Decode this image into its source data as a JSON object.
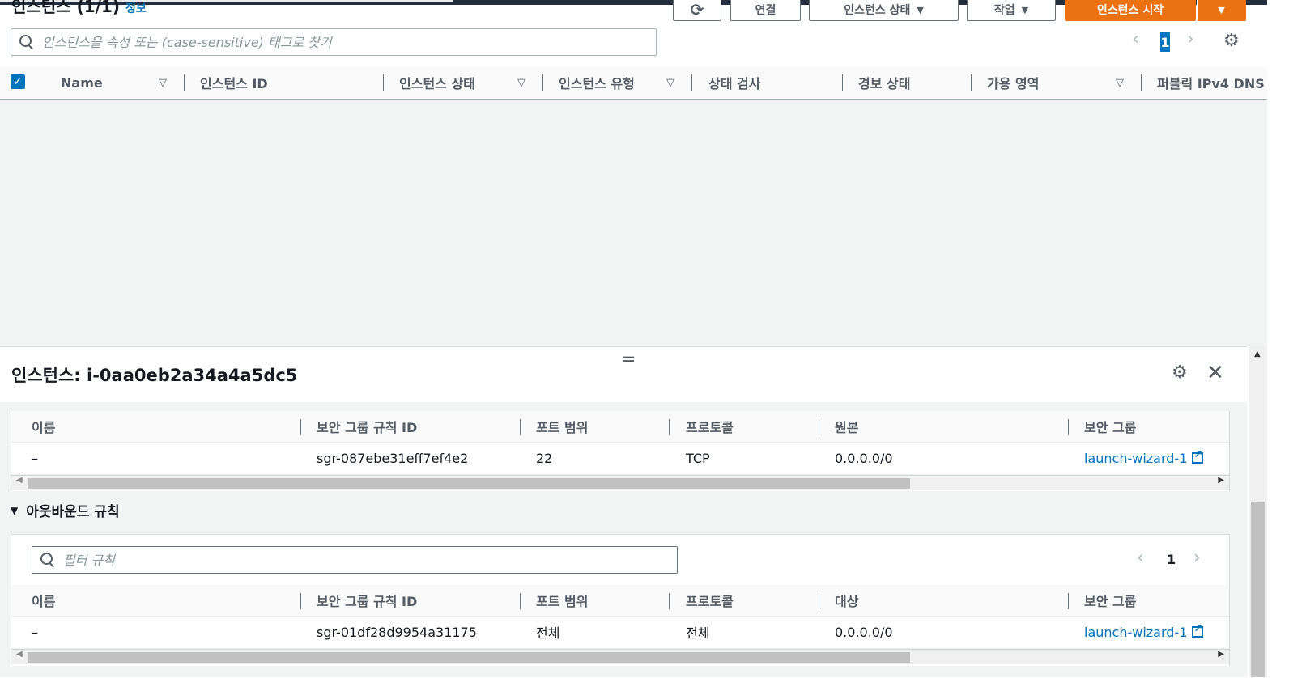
{
  "header": {
    "title": "인스턴스 (1/1)",
    "info_link": "정보",
    "buttons": {
      "refresh": "⟳",
      "connect": "연결",
      "instance_state": "인스턴스 상태",
      "actions": "작업",
      "launch": "인스턴스 시작"
    }
  },
  "search": {
    "placeholder": "인스턴스을 속성 또는 (case-sensitive) 태그로 찾기"
  },
  "pagination": {
    "current_page": "1"
  },
  "instances_table": {
    "columns": [
      "Name",
      "인스턴스 ID",
      "인스턴스 상태",
      "인스턴스 유형",
      "상태 검사",
      "경보 상태",
      "가용 영역",
      "퍼블릭 IPv4 DNS"
    ]
  },
  "detail": {
    "label": "인스턴스:",
    "instance_id": "i-0aa0eb2a34a4a5dc5"
  },
  "inbound": {
    "columns": [
      "이름",
      "보안 그룹 규칙 ID",
      "포트 범위",
      "프로토콜",
      "원본",
      "보안 그룹"
    ],
    "rows": [
      {
        "name": "–",
        "rule_id": "sgr-087ebe31eff7ef4e2",
        "port": "22",
        "protocol": "TCP",
        "source": "0.0.0.0/0",
        "group": "launch-wizard-1"
      }
    ]
  },
  "outbound": {
    "section_title": "아웃바운드 규칙",
    "filter_placeholder": "필터 규칙",
    "page": "1",
    "columns": [
      "이름",
      "보안 그룹 규칙 ID",
      "포트 범위",
      "프로토콜",
      "대상",
      "보안 그룹"
    ],
    "rows": [
      {
        "name": "–",
        "rule_id": "sgr-01df28d9954a31175",
        "port": "전체",
        "protocol": "전체",
        "dest": "0.0.0.0/0",
        "group": "launch-wizard-1"
      }
    ]
  },
  "colors": {
    "accent": "#ec7211",
    "link": "#0073bb",
    "header_bg": "#232f3e"
  }
}
